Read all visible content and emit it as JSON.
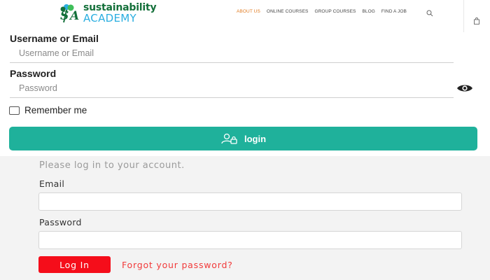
{
  "brand": {
    "logo_mark": "SA",
    "name_top": "sustainability",
    "name_bottom": "ACADEMY",
    "colors": {
      "green": "#14703a",
      "blue": "#2aaee0"
    }
  },
  "nav": {
    "items": [
      {
        "label": "ABOUT US",
        "active": true
      },
      {
        "label": "ONLINE COURSES",
        "active": false
      },
      {
        "label": "GROUP COURSES",
        "active": false
      },
      {
        "label": "BLOG",
        "active": false
      },
      {
        "label": "FIND A JOB",
        "active": false
      }
    ],
    "icons": {
      "search": "search-icon",
      "cart": "shopping-bag-icon"
    },
    "active_color": "#e07a1f"
  },
  "login_form": {
    "username_label": "Username or Email",
    "username_placeholder": "Username or Email",
    "password_label": "Password",
    "password_placeholder": "Password",
    "show_password_icon": "eye-icon",
    "remember_label": "Remember me",
    "submit_label": "login",
    "submit_icon": "user-lock-icon",
    "accent_color": "#1fb19b"
  },
  "secondary_form": {
    "intro": "Please log in to your account.",
    "email_label": "Email",
    "password_label": "Password",
    "submit_label": "Log In",
    "forgot_label": "Forgot your password?",
    "button_color": "#f50d1a"
  }
}
